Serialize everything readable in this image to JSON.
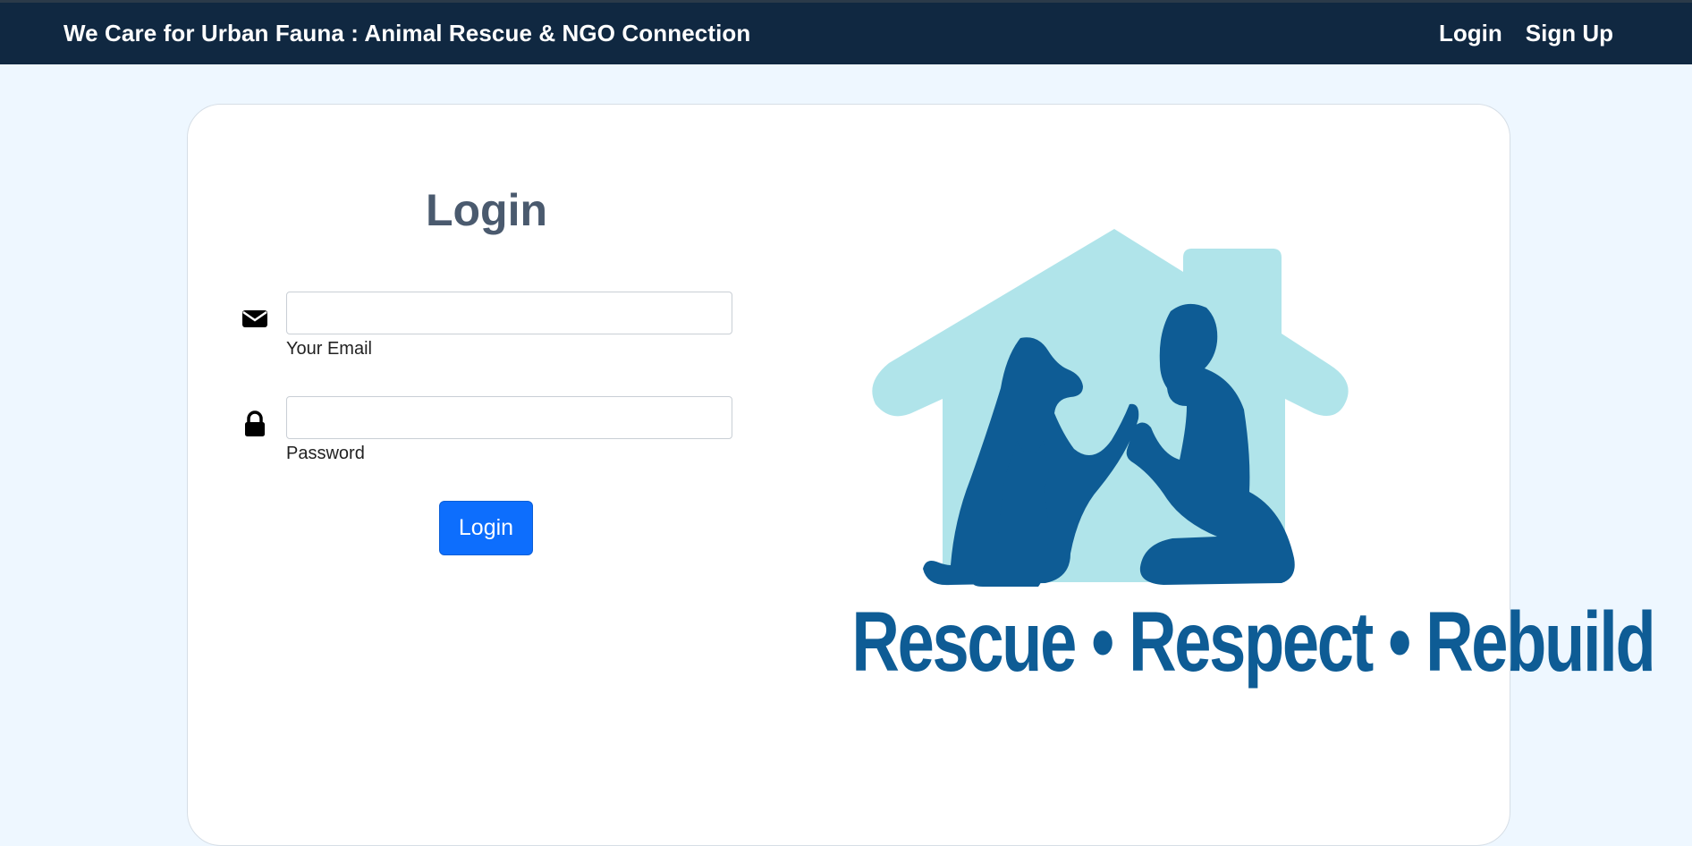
{
  "navbar": {
    "brand": "We Care for Urban Fauna : Animal Rescue & NGO Connection",
    "links": [
      {
        "label": "Login"
      },
      {
        "label": "Sign Up"
      }
    ]
  },
  "form": {
    "title": "Login",
    "email": {
      "label": "Your Email",
      "value": "",
      "icon": "envelope-icon"
    },
    "password": {
      "label": "Password",
      "value": "",
      "icon": "lock-icon"
    },
    "submit_label": "Login"
  },
  "hero": {
    "tagline": "Rescue • Respect • Rebuild",
    "colors": {
      "house": "#b0e4ea",
      "silhouette": "#0e5c95"
    }
  },
  "colors": {
    "navbar": "#102841",
    "page_bg": "#eef7ff",
    "accent": "#0d6efd",
    "title": "#4a5a6e"
  }
}
